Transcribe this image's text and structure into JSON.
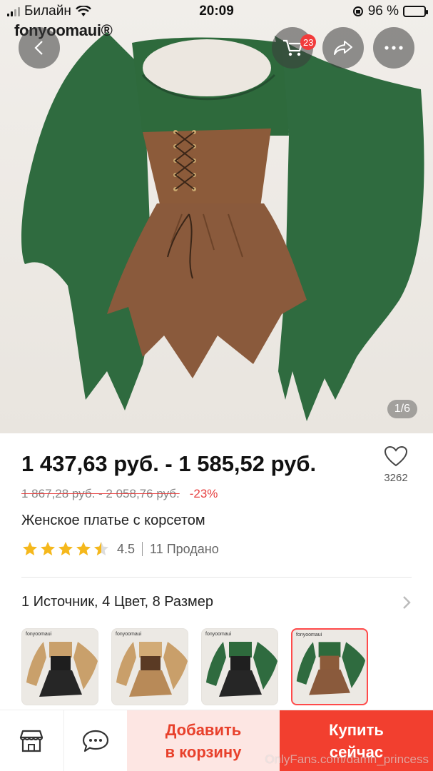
{
  "status_bar": {
    "carrier": "Билайн",
    "time": "20:09",
    "battery_percent": "96 %"
  },
  "brand_watermark": "fonyoomaui®",
  "header": {
    "cart_badge": "23"
  },
  "gallery": {
    "counter": "1/6"
  },
  "product": {
    "price_range": "1 437,63 руб. - 1 585,52 руб.",
    "old_price_range": "1 867,28 руб. - 2 058,76 руб.",
    "discount": "-23%",
    "title": "Женское платье с корсетом",
    "rating": "4.5",
    "rating_stars": 4.5,
    "sold": "11 Продано",
    "favorites_count": "3262"
  },
  "options": {
    "summary": "1 Источник, 4 Цвет, 8 Размер",
    "variants": [
      {
        "brand": "fonyoomaui",
        "color": "black",
        "selected": false
      },
      {
        "brand": "fonyoomaui",
        "color": "tan",
        "selected": false
      },
      {
        "brand": "fonyoomaui",
        "color": "green-black",
        "selected": false
      },
      {
        "brand": "fonyoomaui",
        "color": "green-brown",
        "selected": true
      }
    ]
  },
  "bottom_bar": {
    "add_to_cart_line1": "Добавить",
    "add_to_cart_line2": "в корзину",
    "buy_now_line1": "Купить",
    "buy_now_line2": "сейчас"
  },
  "footer_watermark": "OnlyFans.com/damn_princess",
  "colors": {
    "accent": "#f23f2f",
    "accent_light": "#fde6e3",
    "star": "#f5b81c",
    "discount": "#e64040",
    "dress_green": "#2f6b3f",
    "dress_brown": "#8a5a3c"
  }
}
